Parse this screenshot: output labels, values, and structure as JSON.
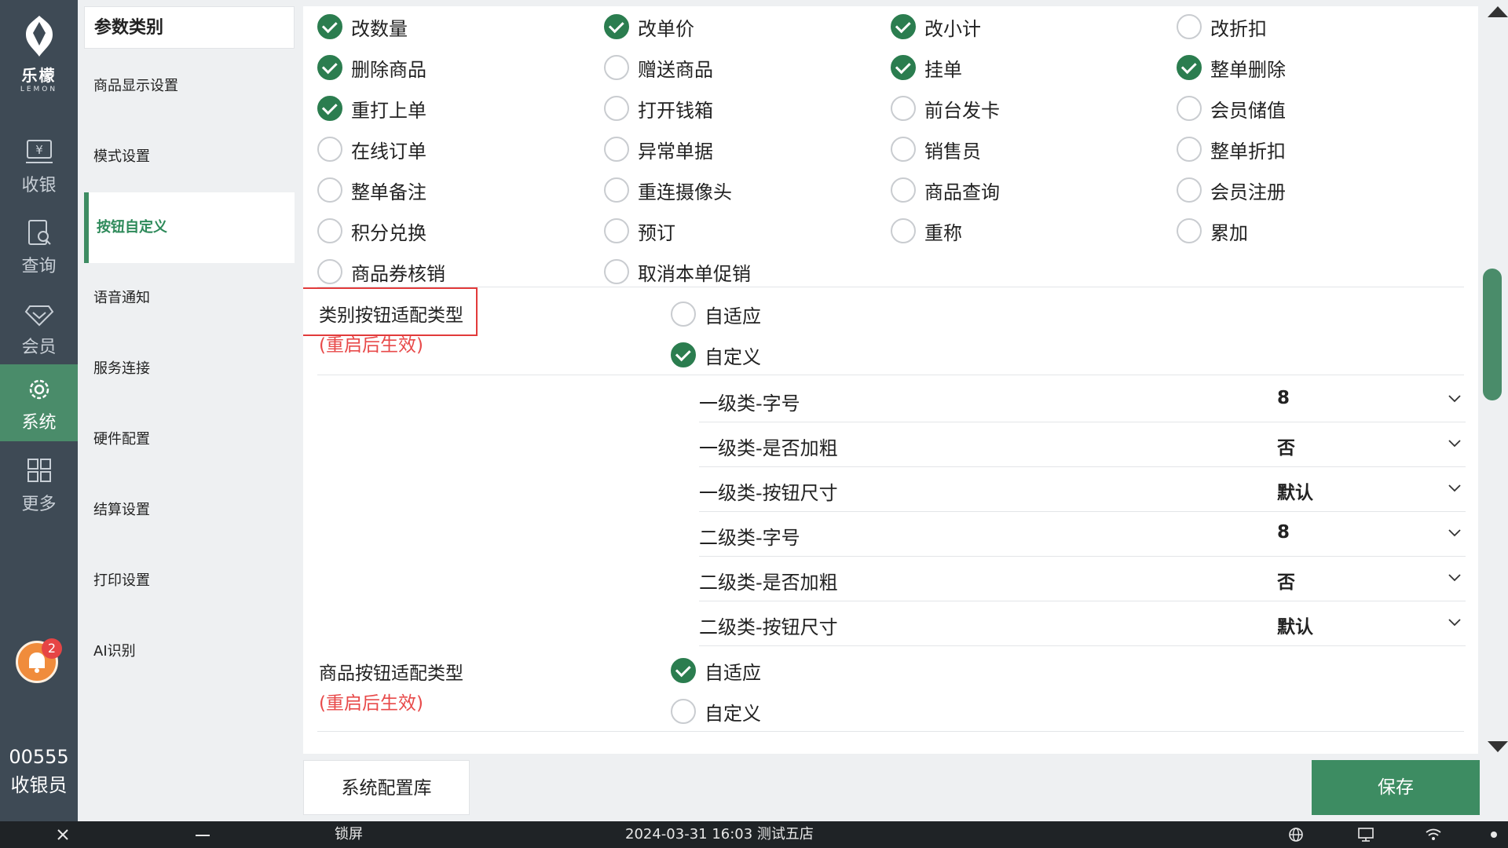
{
  "app": {
    "brand_cn": "乐檬",
    "brand_en": "LEMON"
  },
  "leftnav": {
    "items": [
      {
        "label": "收银",
        "icon": "cash-register-icon"
      },
      {
        "label": "查询",
        "icon": "search-doc-icon"
      },
      {
        "label": "会员",
        "icon": "diamond-icon"
      },
      {
        "label": "系统",
        "icon": "gear-icon",
        "active": true
      },
      {
        "label": "更多",
        "icon": "grid-icon"
      }
    ],
    "notification_count": "2",
    "user_code": "00555",
    "user_role": "收银员"
  },
  "category_bar": {
    "title": "参数类别",
    "items": [
      {
        "label": "商品显示设置"
      },
      {
        "label": "模式设置"
      },
      {
        "label": "按钮自定义",
        "active": true
      },
      {
        "label": "语音通知"
      },
      {
        "label": "服务连接"
      },
      {
        "label": "硬件配置"
      },
      {
        "label": "结算设置"
      },
      {
        "label": "打印设置"
      },
      {
        "label": "AI识别"
      }
    ]
  },
  "button_options": [
    {
      "label": "改数量",
      "checked": true
    },
    {
      "label": "改单价",
      "checked": true
    },
    {
      "label": "改小计",
      "checked": true
    },
    {
      "label": "改折扣",
      "checked": false
    },
    {
      "label": "删除商品",
      "checked": true
    },
    {
      "label": "赠送商品",
      "checked": false
    },
    {
      "label": "挂单",
      "checked": true
    },
    {
      "label": "整单删除",
      "checked": true
    },
    {
      "label": "重打上单",
      "checked": true
    },
    {
      "label": "打开钱箱",
      "checked": false
    },
    {
      "label": "前台发卡",
      "checked": false
    },
    {
      "label": "会员储值",
      "checked": false
    },
    {
      "label": "在线订单",
      "checked": false
    },
    {
      "label": "异常单据",
      "checked": false
    },
    {
      "label": "销售员",
      "checked": false
    },
    {
      "label": "整单折扣",
      "checked": false
    },
    {
      "label": "整单备注",
      "checked": false
    },
    {
      "label": "重连摄像头",
      "checked": false
    },
    {
      "label": "商品查询",
      "checked": false
    },
    {
      "label": "会员注册",
      "checked": false
    },
    {
      "label": "积分兑换",
      "checked": false
    },
    {
      "label": "预订",
      "checked": false
    },
    {
      "label": "重称",
      "checked": false
    },
    {
      "label": "累加",
      "checked": false
    },
    {
      "label": "商品券核销",
      "checked": false
    },
    {
      "label": "取消本单促销",
      "checked": false
    }
  ],
  "category_fit": {
    "label": "类别按钮适配类型",
    "note": "(重启后生效)",
    "options": [
      {
        "label": "自适应",
        "checked": false
      },
      {
        "label": "自定义",
        "checked": true
      }
    ],
    "settings": [
      {
        "key": "一级类-字号",
        "value": "8"
      },
      {
        "key": "一级类-是否加粗",
        "value": "否"
      },
      {
        "key": "一级类-按钮尺寸",
        "value": "默认"
      },
      {
        "key": "二级类-字号",
        "value": "8"
      },
      {
        "key": "二级类-是否加粗",
        "value": "否"
      },
      {
        "key": "二级类-按钮尺寸",
        "value": "默认"
      }
    ]
  },
  "product_fit": {
    "label": "商品按钮适配类型",
    "note": "(重启后生效)",
    "options": [
      {
        "label": "自适应",
        "checked": true
      },
      {
        "label": "自定义",
        "checked": false
      }
    ]
  },
  "footer": {
    "config_label": "系统配置库",
    "save_label": "保存"
  },
  "taskbar": {
    "lock_label": "锁屏",
    "datetime_store": "2024-03-31 16:03 测试五店"
  },
  "colors": {
    "nav_bg": "#3e4a55",
    "accent": "#3d8c62",
    "check": "#2b7d4f",
    "note": "#e84a4a"
  }
}
